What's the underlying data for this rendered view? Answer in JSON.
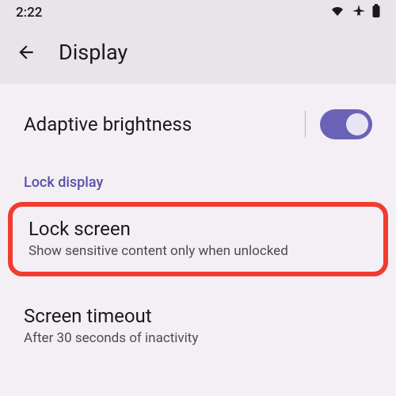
{
  "status": {
    "time": "2:22"
  },
  "header": {
    "title": "Display"
  },
  "adaptive": {
    "label": "Adaptive brightness",
    "enabled": true
  },
  "section": {
    "lock_display": "Lock display"
  },
  "lock_screen": {
    "title": "Lock screen",
    "subtitle": "Show sensitive content only when unlocked"
  },
  "screen_timeout": {
    "title": "Screen timeout",
    "subtitle": "After 30 seconds of inactivity"
  }
}
